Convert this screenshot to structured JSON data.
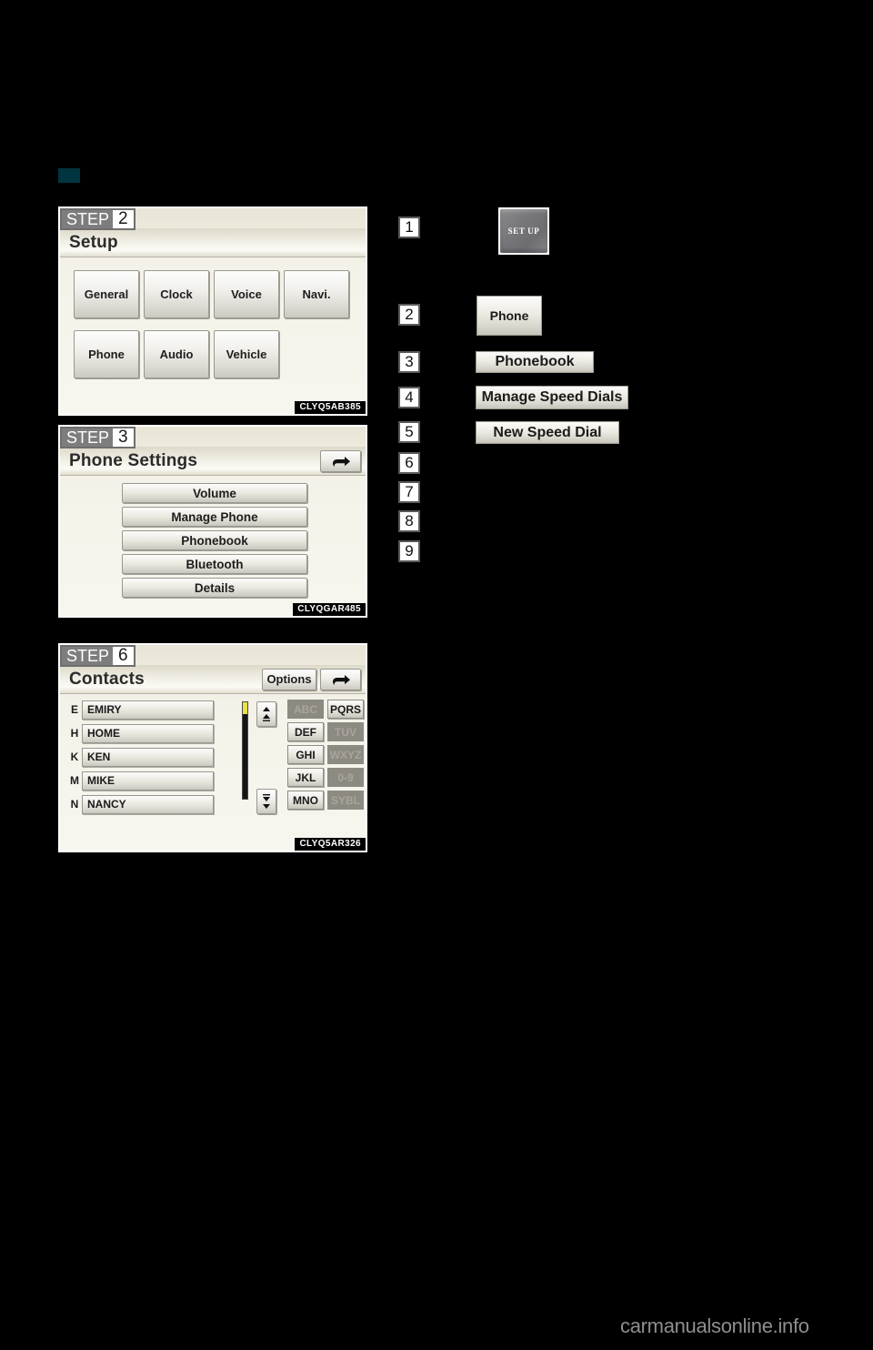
{
  "page": {
    "background_color": "#000000",
    "section_marker_color": "#00343e",
    "watermark": "carmanualsonline.info"
  },
  "screens": [
    {
      "step_word": "STEP",
      "step_number": "2",
      "title": "Setup",
      "code": "CLYQ5AB385",
      "buttons": [
        "General",
        "Clock",
        "Voice",
        "Navi.",
        "Phone",
        "Audio",
        "Vehicle"
      ]
    },
    {
      "step_word": "STEP",
      "step_number": "3",
      "title": "Phone Settings",
      "code": "CLYQGAR485",
      "back_icon": "back-arrow-icon",
      "buttons": [
        "Volume",
        "Manage Phone",
        "Phonebook",
        "Bluetooth",
        "Details"
      ]
    },
    {
      "step_word": "STEP",
      "step_number": "6",
      "title": "Contacts",
      "code": "CLYQ5AR326",
      "options_label": "Options",
      "back_icon": "back-arrow-icon",
      "contacts": [
        {
          "letter": "E",
          "name": "EMIRY"
        },
        {
          "letter": "H",
          "name": "HOME"
        },
        {
          "letter": "K",
          "name": "KEN"
        },
        {
          "letter": "M",
          "name": "MIKE"
        },
        {
          "letter": "N",
          "name": "NANCY"
        }
      ],
      "scrollbar": {
        "thumb_color": "#e8e24a",
        "track_color": "#151515"
      },
      "keypad": [
        {
          "left": "ABC",
          "left_enabled": false,
          "right": "PQRS",
          "right_enabled": true
        },
        {
          "left": "DEF",
          "left_enabled": true,
          "right": "TUV",
          "right_enabled": false
        },
        {
          "left": "GHI",
          "left_enabled": true,
          "right": "WXYZ",
          "right_enabled": false
        },
        {
          "left": "JKL",
          "left_enabled": true,
          "right": "0-9",
          "right_enabled": false
        },
        {
          "left": "MNO",
          "left_enabled": true,
          "right": "SYBL",
          "right_enabled": false
        }
      ],
      "scroll_up_icon": "scroll-up-icon",
      "scroll_down_icon": "scroll-down-icon"
    }
  ],
  "steps": [
    {
      "number": "1",
      "label": "SET UP",
      "kind": "hardware-button"
    },
    {
      "number": "2",
      "label": "Phone",
      "kind": "screen-button"
    },
    {
      "number": "3",
      "label": "Phonebook",
      "kind": "screen-button"
    },
    {
      "number": "4",
      "label": "Manage Speed Dials",
      "kind": "screen-button"
    },
    {
      "number": "5",
      "label": "New Speed Dial",
      "kind": "screen-button"
    },
    {
      "number": "6",
      "label": "",
      "kind": "none"
    },
    {
      "number": "7",
      "label": "",
      "kind": "none"
    },
    {
      "number": "8",
      "label": "",
      "kind": "none"
    },
    {
      "number": "9",
      "label": "",
      "kind": "none"
    }
  ]
}
